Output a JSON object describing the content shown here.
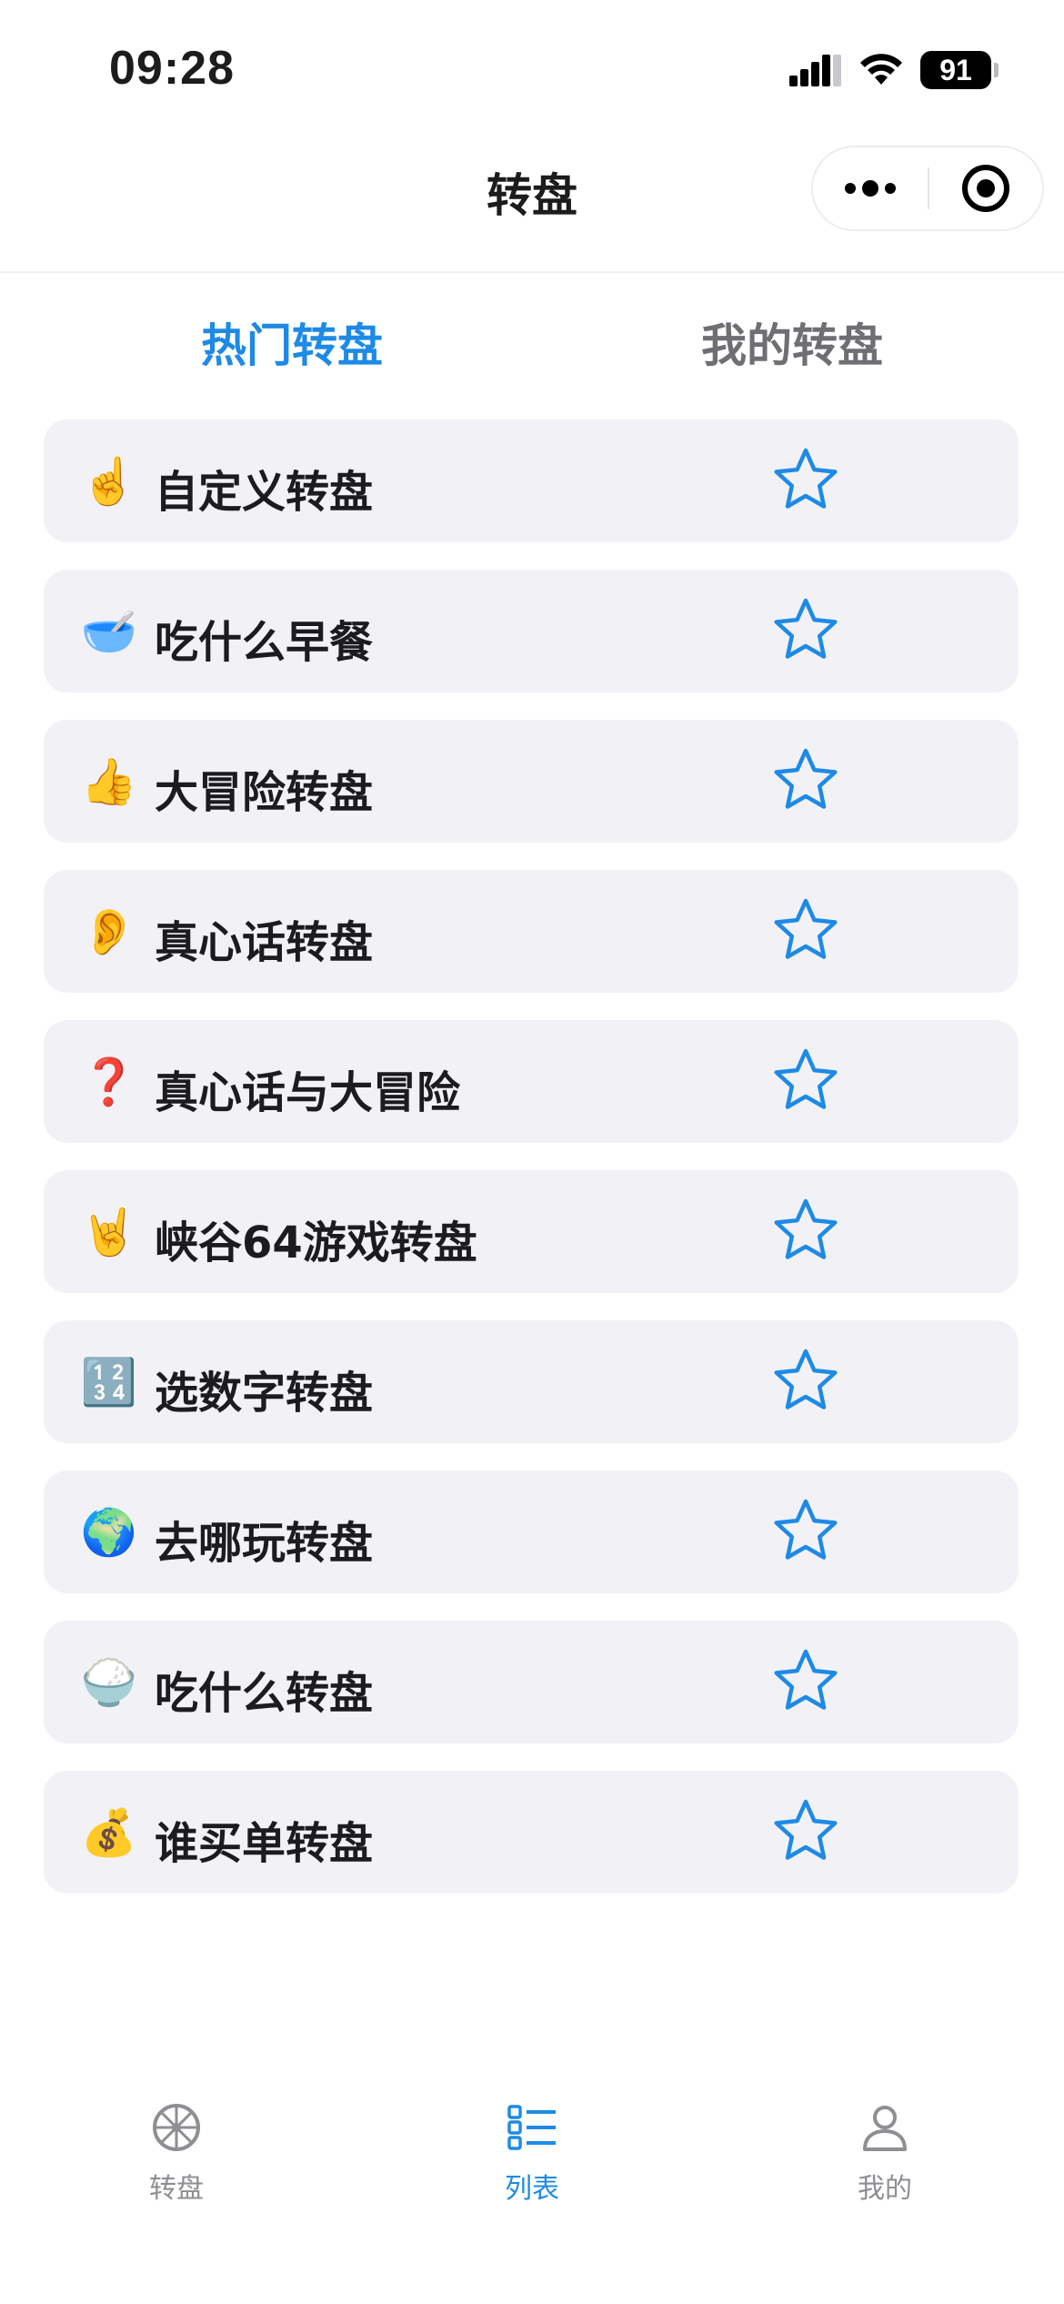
{
  "status_bar": {
    "time": "09:28",
    "battery": "91"
  },
  "nav": {
    "title": "转盘"
  },
  "tabs": [
    {
      "label": "热门转盘",
      "active": true
    },
    {
      "label": "我的转盘",
      "active": false
    }
  ],
  "items": [
    {
      "emoji": "☝️",
      "label": "自定义转盘"
    },
    {
      "emoji": "🥣",
      "label": "吃什么早餐"
    },
    {
      "emoji": "👍",
      "label": "大冒险转盘"
    },
    {
      "emoji": "👂",
      "label": "真心话转盘"
    },
    {
      "emoji": "❓",
      "label": "真心话与大冒险"
    },
    {
      "emoji": "🤘",
      "label": "峡谷64游戏转盘"
    },
    {
      "emoji": "🔢",
      "label": "选数字转盘"
    },
    {
      "emoji": "🌍",
      "label": "去哪玩转盘"
    },
    {
      "emoji": "🍚",
      "label": "吃什么转盘"
    },
    {
      "emoji": "💰",
      "label": "谁买单转盘"
    }
  ],
  "tab_bar": [
    {
      "label": "转盘",
      "icon": "wheel-icon",
      "active": false
    },
    {
      "label": "列表",
      "icon": "list-icon",
      "active": true
    },
    {
      "label": "我的",
      "icon": "person-icon",
      "active": false
    }
  ],
  "colors": {
    "accent": "#1e8ae6",
    "item_background": "#f2f2f6",
    "inactive": "#8e8e93"
  }
}
